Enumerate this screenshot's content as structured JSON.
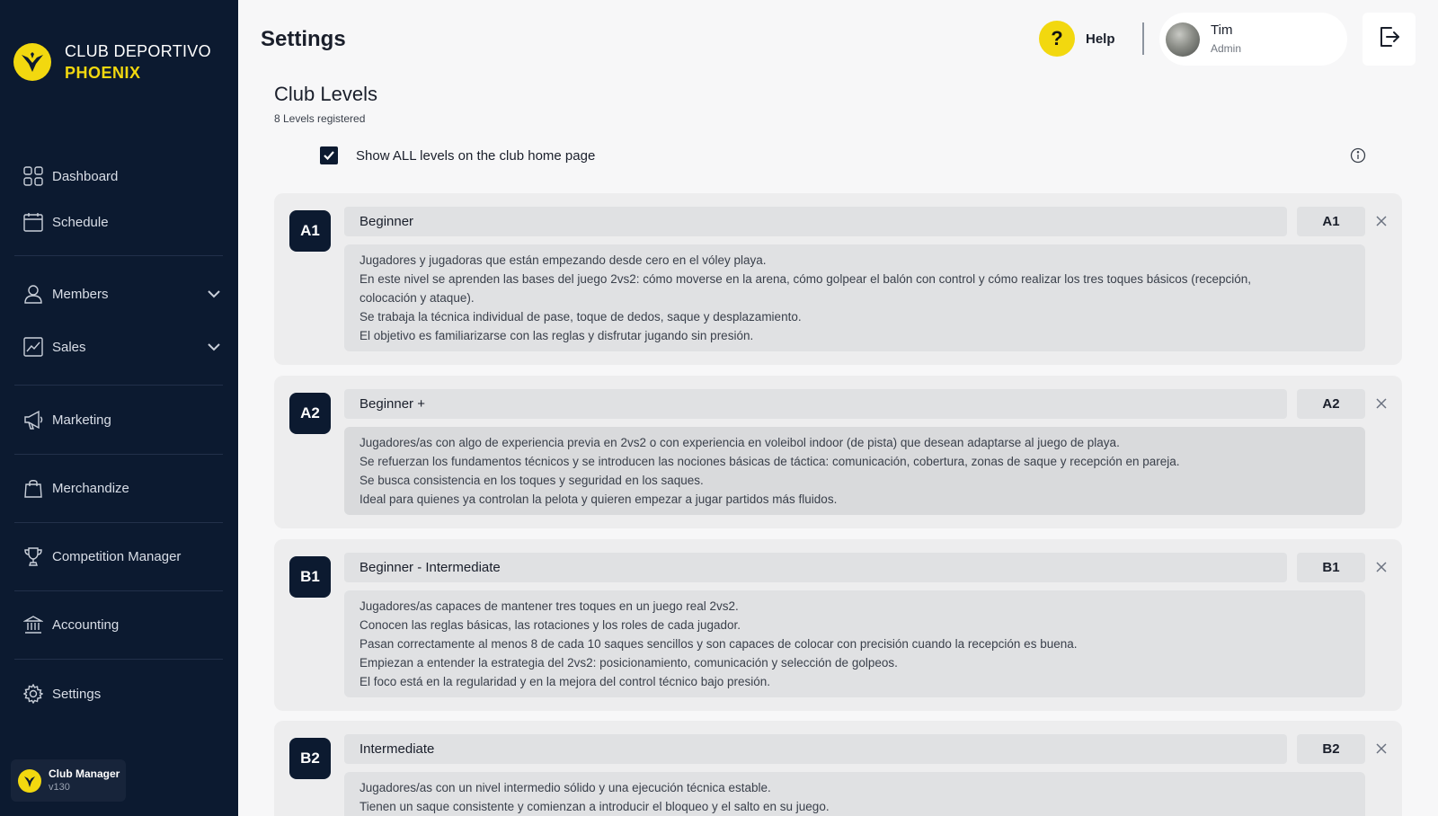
{
  "brand": {
    "line1": "CLUB DEPORTIVO",
    "line2": "PHOENIX"
  },
  "sidebar": {
    "items": [
      {
        "label": "Dashboard",
        "icon": "dashboard-grid-icon"
      },
      {
        "label": "Schedule",
        "icon": "calendar-icon"
      },
      {
        "label": "Members",
        "icon": "user-icon",
        "expandable": true
      },
      {
        "label": "Sales",
        "icon": "chart-line-icon",
        "expandable": true
      },
      {
        "label": "Marketing",
        "icon": "megaphone-icon"
      },
      {
        "label": "Merchandize",
        "icon": "shopping-bag-icon"
      },
      {
        "label": "Competition Manager",
        "icon": "trophy-icon"
      },
      {
        "label": "Accounting",
        "icon": "bank-icon"
      },
      {
        "label": "Settings",
        "icon": "gear-icon"
      }
    ],
    "app": {
      "name": "Club Manager",
      "version": "v130"
    }
  },
  "header": {
    "title": "Settings",
    "help_label": "Help",
    "user": {
      "name": "Tim",
      "role": "Admin"
    }
  },
  "section": {
    "title": "Club Levels",
    "subtitle": "8 Levels registered",
    "show_all_label": "Show ALL levels on the club home page",
    "show_all_checked": true
  },
  "levels": [
    {
      "code": "A1",
      "name": "Beginner",
      "description": [
        "Jugadores y jugadoras que están empezando desde cero en el vóley playa.",
        "En este nivel se aprenden las bases del juego 2vs2: cómo moverse en la arena, cómo golpear el balón con control y cómo realizar los tres toques básicos (recepción,",
        "colocación y ataque).",
        "Se trabaja la técnica individual de pase, toque de dedos, saque y desplazamiento.",
        "El objetivo es familiarizarse con las reglas y disfrutar jugando sin presión."
      ]
    },
    {
      "code": "A2",
      "name": "Beginner +",
      "description": [
        "Jugadores/as con algo de experiencia previa en 2vs2 o con experiencia en voleibol indoor (de pista) que desean adaptarse al juego de playa.",
        "Se refuerzan los fundamentos técnicos y se introducen las nociones básicas de táctica: comunicación, cobertura, zonas de saque y recepción en pareja.",
        "Se busca consistencia en los toques y seguridad en los saques.",
        "Ideal para quienes ya controlan la pelota y quieren empezar a jugar partidos más fluidos."
      ]
    },
    {
      "code": "B1",
      "name": "Beginner - Intermediate",
      "description": [
        "Jugadores/as capaces de mantener tres toques en un juego real 2vs2.",
        "Conocen las reglas básicas, las rotaciones y los roles de cada jugador.",
        "Pasan correctamente al menos 8 de cada 10 saques sencillos y son capaces de colocar con precisión cuando la recepción es buena.",
        "Empiezan a entender la estrategia del 2vs2: posicionamiento, comunicación y selección de golpeos.",
        "El foco está en la regularidad y en la mejora del control técnico bajo presión."
      ]
    },
    {
      "code": "B2",
      "name": "Intermediate",
      "description": [
        "Jugadores/as con un nivel intermedio sólido y una ejecución técnica estable.",
        "Tienen un saque consistente y comienzan a introducir el bloqueo y el salto en su juego."
      ]
    }
  ],
  "colors": {
    "sidebar_bg": "#0c1a30",
    "accent": "#f2d80f",
    "card_bg": "#ededee",
    "field_bg": "#e0e1e3"
  }
}
